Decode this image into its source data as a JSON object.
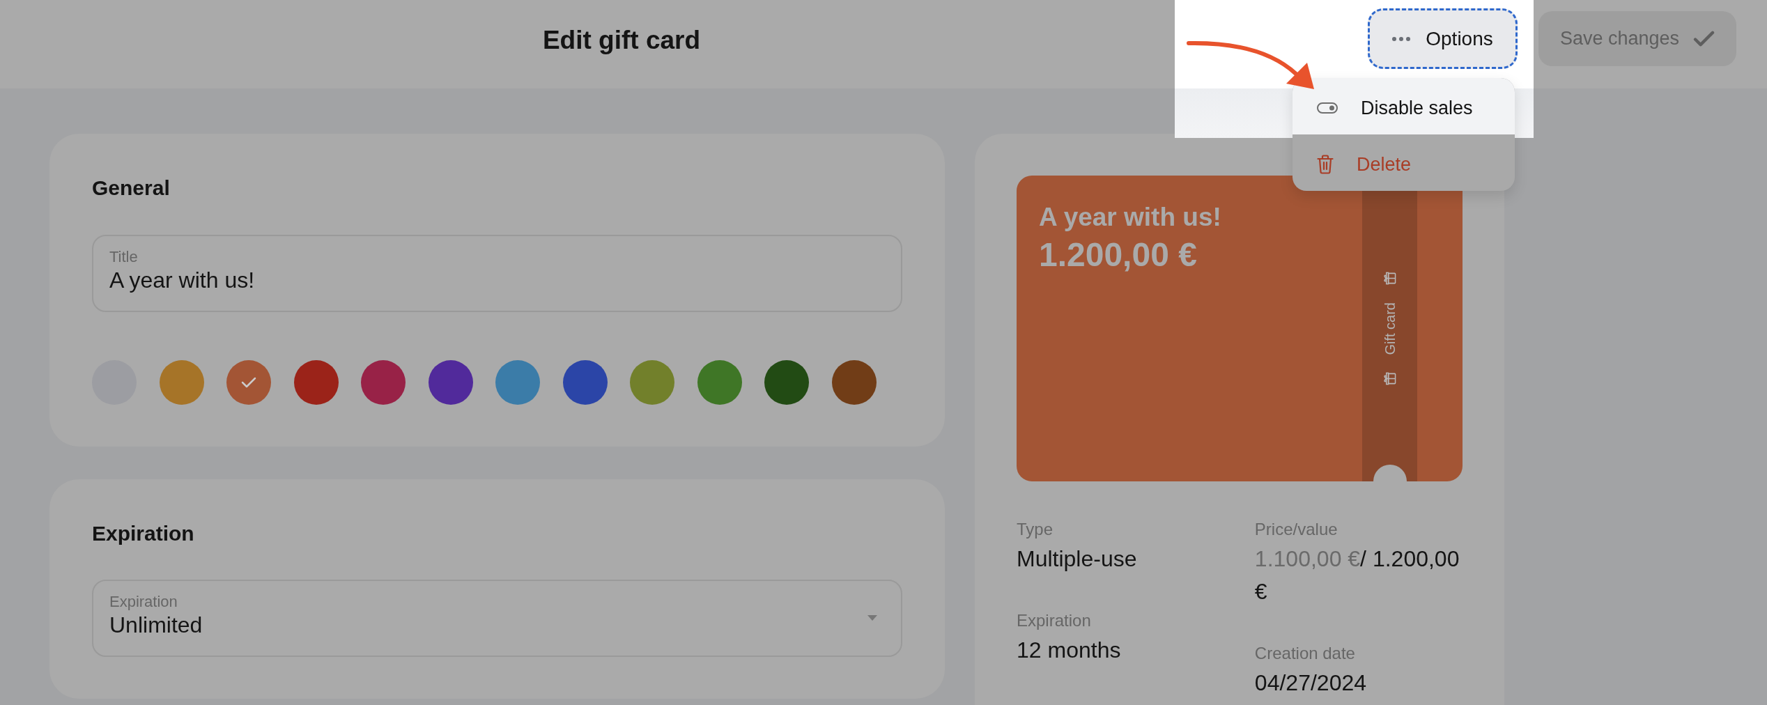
{
  "header": {
    "title": "Edit gift card",
    "options_button": {
      "label": "Options"
    },
    "save_button": {
      "label": "Save changes",
      "disabled": true
    }
  },
  "options_menu": {
    "items": [
      {
        "kind": "toggle",
        "label": "Disable sales",
        "highlighted": true
      },
      {
        "kind": "delete",
        "label": "Delete",
        "highlighted": false
      }
    ]
  },
  "general": {
    "heading": "General",
    "title_field": {
      "label": "Title",
      "value": "A year with us!"
    },
    "colors": [
      {
        "color": "#9c9da2",
        "selected": false
      },
      {
        "color": "#a67428",
        "selected": false
      },
      {
        "color": "#a35535",
        "selected": true
      },
      {
        "color": "#9b2319",
        "selected": false
      },
      {
        "color": "#982247",
        "selected": false
      },
      {
        "color": "#512a9b",
        "selected": false
      },
      {
        "color": "#3b7ca8",
        "selected": false
      },
      {
        "color": "#2b45a7",
        "selected": false
      },
      {
        "color": "#72802b",
        "selected": false
      },
      {
        "color": "#3f7626",
        "selected": false
      },
      {
        "color": "#224b14",
        "selected": false
      },
      {
        "color": "#713d17",
        "selected": false
      }
    ]
  },
  "expiration": {
    "heading": "Expiration",
    "select": {
      "label": "Expiration",
      "value": "Unlimited"
    }
  },
  "preview": {
    "card": {
      "title": "A year with us!",
      "amount": "1.200,00 €",
      "stripe_label": "Gift card"
    },
    "detail_columns": [
      [
        {
          "label": "Type",
          "value": "Multiple-use"
        },
        {
          "label": "Expiration",
          "value": "12 months"
        }
      ],
      [
        {
          "label": "Price/value",
          "price": "1.100,00 €",
          "value": "/ 1.200,00 €"
        },
        {
          "label": "Creation date",
          "value": "04/27/2024"
        }
      ]
    ]
  }
}
